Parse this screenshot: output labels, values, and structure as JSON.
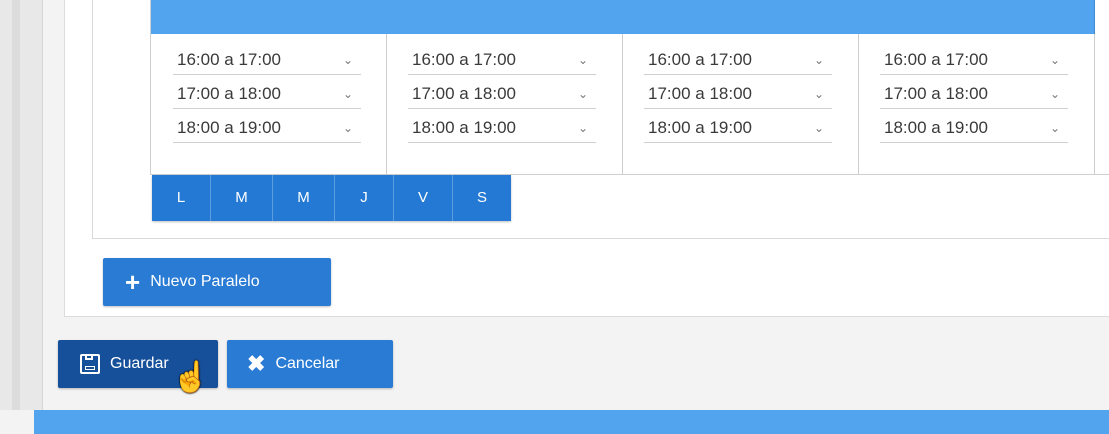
{
  "schedule": {
    "columns": [
      {
        "slots": [
          {
            "label": "16:00 a 17:00"
          },
          {
            "label": "17:00 a 18:00"
          },
          {
            "label": "18:00 a 19:00"
          }
        ]
      },
      {
        "slots": [
          {
            "label": "16:00 a 17:00"
          },
          {
            "label": "17:00 a 18:00"
          },
          {
            "label": "18:00 a 19:00"
          }
        ]
      },
      {
        "slots": [
          {
            "label": "16:00 a 17:00"
          },
          {
            "label": "17:00 a 18:00"
          },
          {
            "label": "18:00 a 19:00"
          }
        ]
      },
      {
        "slots": [
          {
            "label": "16:00 a 17:00"
          },
          {
            "label": "17:00 a 18:00"
          },
          {
            "label": "18:00 a 19:00"
          }
        ]
      }
    ],
    "chevron": "⌄"
  },
  "days": [
    {
      "label": "L"
    },
    {
      "label": "M"
    },
    {
      "label": "M"
    },
    {
      "label": "J"
    },
    {
      "label": "V"
    },
    {
      "label": "S"
    }
  ],
  "actions": {
    "nuevo_paralelo": "Nuevo Paralelo",
    "nuevo_plus": "+",
    "guardar": "Guardar",
    "cancelar": "Cancelar",
    "cancelar_x": "✖"
  },
  "icons": {
    "cursor": "hand-pointer-icon"
  },
  "colors": {
    "header_blue": "#52a4ee",
    "button_blue": "#2a7bd4",
    "button_dark_blue": "#17509a"
  }
}
